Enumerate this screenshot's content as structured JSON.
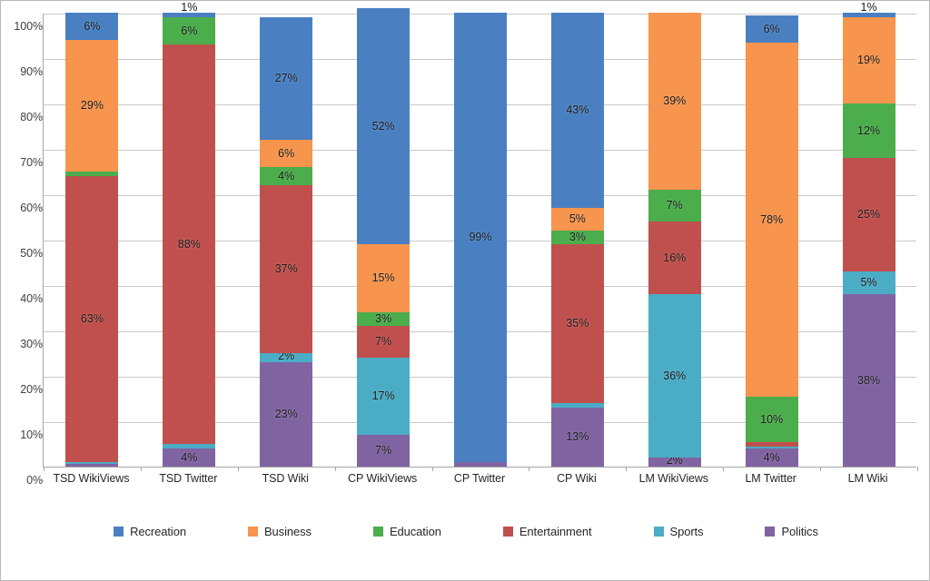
{
  "chart_data": {
    "type": "bar",
    "variant": "stacked-100-percent",
    "title": "",
    "subtitle": "",
    "xlabel": "",
    "ylabel": "",
    "ylim": [
      0,
      100
    ],
    "ytick_labels": [
      "0%",
      "10%",
      "20%",
      "30%",
      "40%",
      "50%",
      "60%",
      "70%",
      "80%",
      "90%",
      "100%"
    ],
    "ytick_values": [
      0,
      10,
      20,
      30,
      40,
      50,
      60,
      70,
      80,
      90,
      100
    ],
    "grid": true,
    "legend_position": "bottom",
    "categories": [
      "TSD WikiViews",
      "TSD Twitter",
      "TSD Wiki",
      "CP WikiViews",
      "CP Twitter",
      "CP Wiki",
      "LM WikiViews",
      "LM Twitter",
      "LM Wiki"
    ],
    "series": [
      {
        "name": "Recreation",
        "color": "#4a80c2",
        "values": [
          6,
          1,
          27,
          52,
          99,
          43,
          0,
          6,
          1
        ],
        "labels": [
          "6%",
          "1%",
          "27%",
          "52%",
          "99%",
          "43%",
          "",
          "6%",
          "1%"
        ]
      },
      {
        "name": "Business",
        "color": "#f7944d",
        "values": [
          29,
          0,
          6,
          15,
          0,
          5,
          39,
          78,
          19
        ],
        "labels": [
          "29%",
          "",
          "6%",
          "15%",
          "",
          "5%",
          "39%",
          "78%",
          "19%"
        ]
      },
      {
        "name": "Education",
        "color": "#4bad4b",
        "values": [
          1,
          6,
          4,
          3,
          0,
          3,
          7,
          10,
          12
        ],
        "labels": [
          "1%",
          "6%",
          "4%",
          "3%",
          "",
          "3%",
          "7%",
          "10%",
          "12%"
        ]
      },
      {
        "name": "Entertainment",
        "color": "#c0504d",
        "values": [
          63,
          88,
          37,
          7,
          0,
          35,
          16,
          1,
          25
        ],
        "labels": [
          "63%",
          "88%",
          "37%",
          "7%",
          "",
          "35%",
          "16%",
          "1%",
          "25%"
        ]
      },
      {
        "name": "Sports",
        "color": "#4bacc6",
        "values": [
          0.4,
          1,
          2,
          17,
          0,
          1,
          36,
          0.4,
          5
        ],
        "labels": [
          "",
          "1%",
          "2%",
          "17%",
          "",
          "1%",
          "36%",
          "",
          "5%"
        ]
      },
      {
        "name": "Politics",
        "color": "#8064a2",
        "values": [
          0.6,
          4,
          23,
          7,
          1,
          13,
          2,
          4,
          38
        ],
        "labels": [
          "",
          "4%",
          "23%",
          "7%",
          "1%",
          "13%",
          "2%",
          "4%",
          "38%"
        ]
      }
    ]
  },
  "legend": {
    "items": [
      {
        "label": "Recreation",
        "color": "#4a80c2"
      },
      {
        "label": "Business",
        "color": "#f7944d"
      },
      {
        "label": "Education",
        "color": "#4bad4b"
      },
      {
        "label": "Entertainment",
        "color": "#c0504d"
      },
      {
        "label": "Sports",
        "color": "#4bacc6"
      },
      {
        "label": "Politics",
        "color": "#8064a2"
      }
    ]
  }
}
